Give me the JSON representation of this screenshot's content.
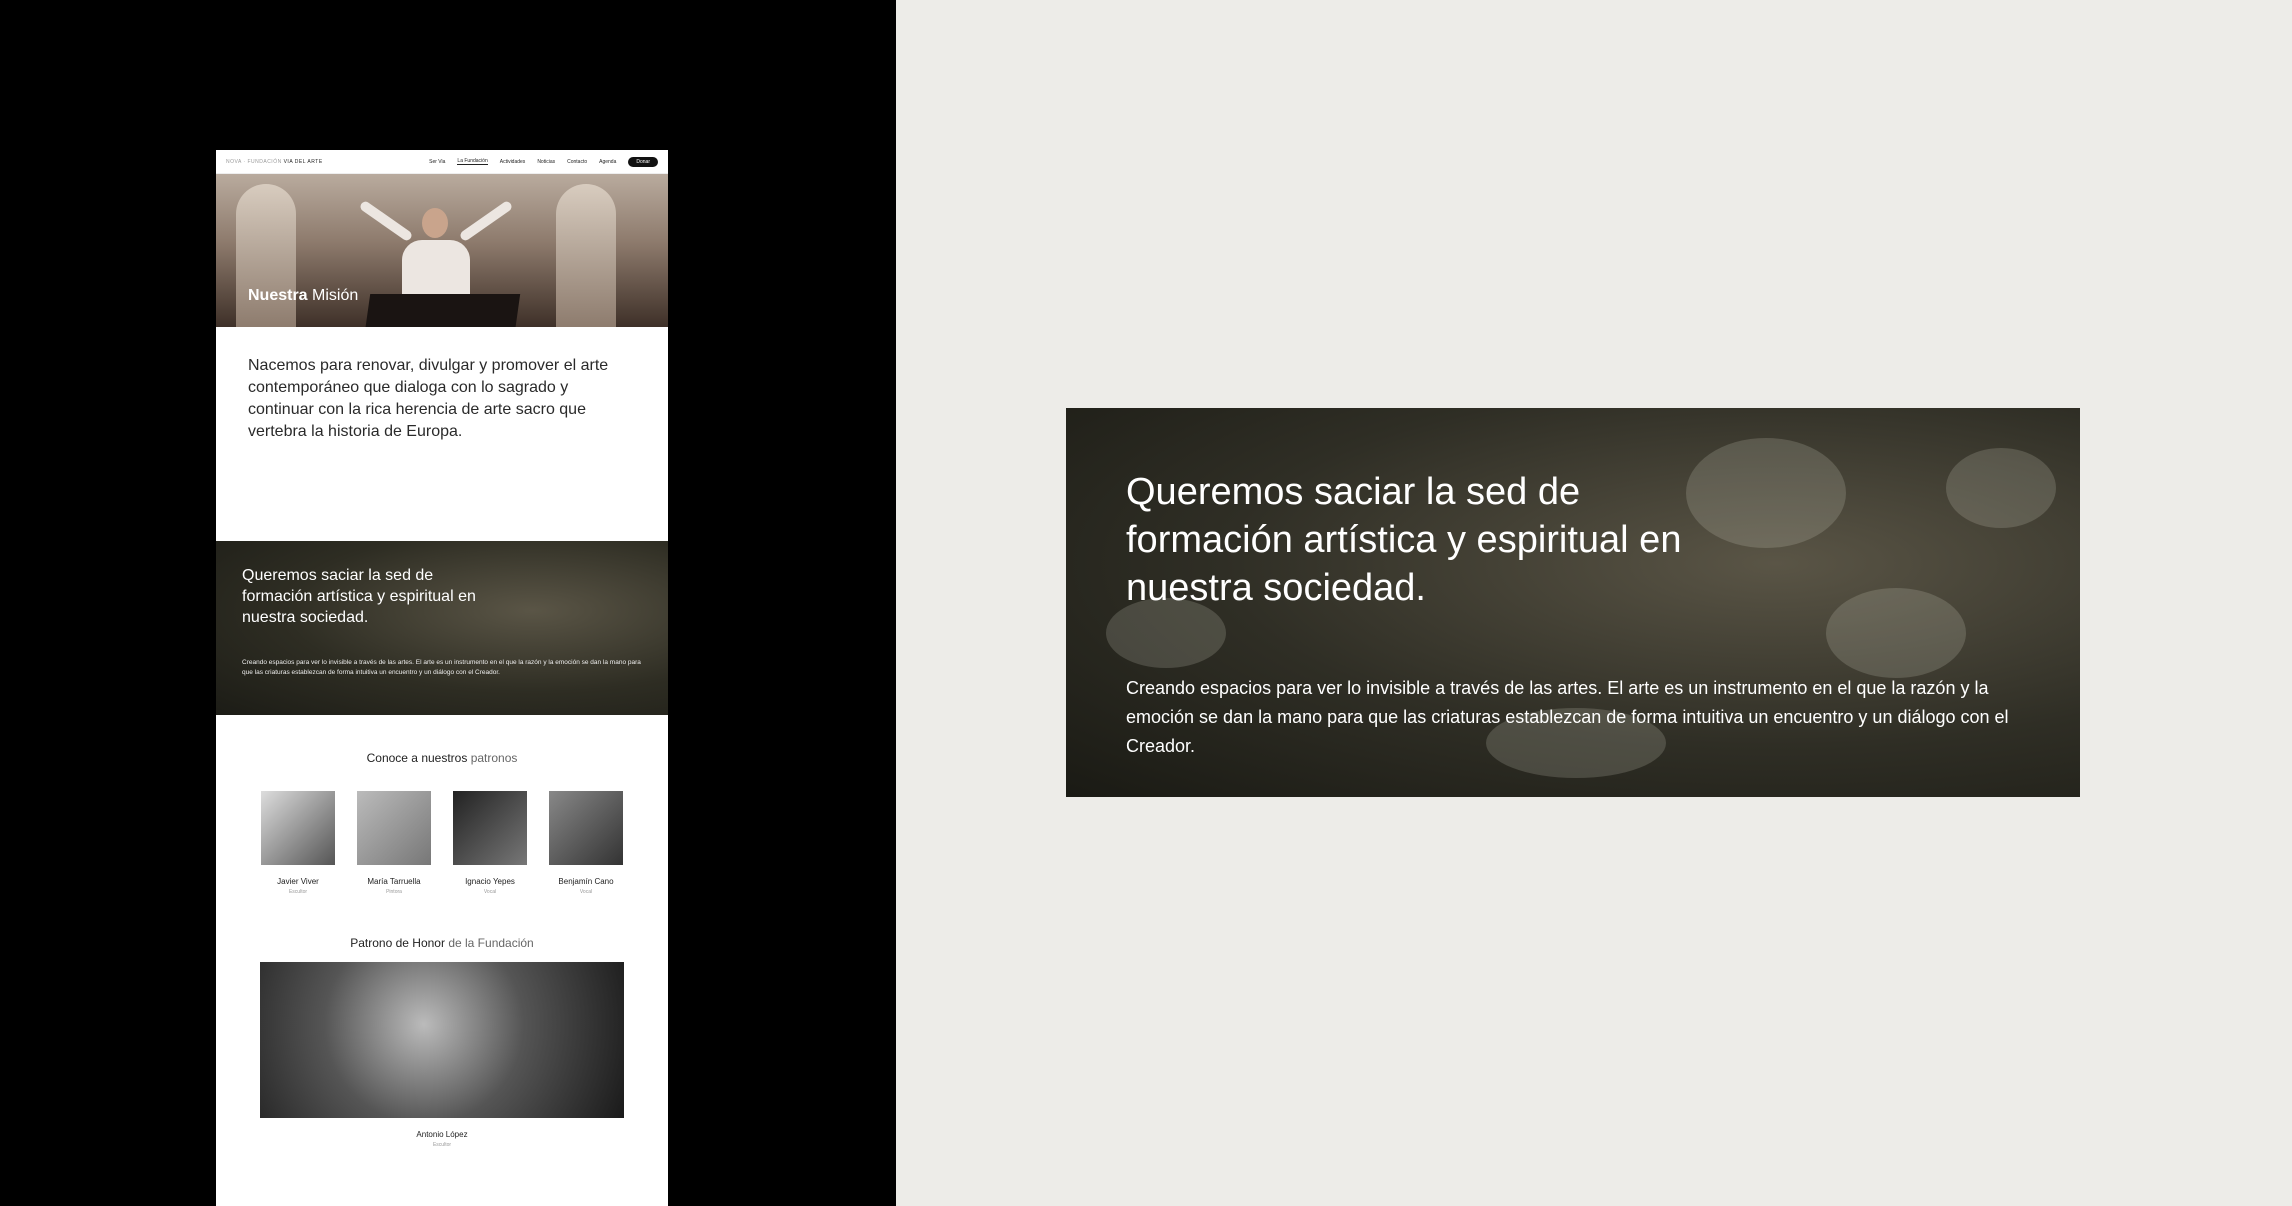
{
  "site": {
    "nav": {
      "logo_prefix": "NOVA · FUNDACIÓN",
      "logo_main": "VIA DEL ARTE",
      "links": [
        "Ser Via",
        "La Fundación",
        "Actividades",
        "Noticias",
        "Contacto",
        "Agenda"
      ],
      "donate": "Donar"
    },
    "hero": {
      "title_bold": "Nuestra",
      "title_light": "Misión"
    },
    "mission_text": "Nacemos para renovar, divulgar y promover el arte contemporáneo que dialoga con lo sagrado y continuar con la rica herencia de arte sacro que vertebra la historia de Europa.",
    "quote": {
      "heading": "Queremos saciar la sed de formación artística y espiritual en nuestra sociedad.",
      "body": "Creando espacios para ver lo invisible a través de las artes. El arte es un instrumento en el que la razón y la emoción se dan la mano para que las criaturas establezcan de forma intuitiva un encuentro y un diálogo con el Creador."
    },
    "patrons": {
      "heading_main": "Conoce a nuestros",
      "heading_light": "patronos",
      "items": [
        {
          "name": "Javier Viver",
          "role": "Escultor"
        },
        {
          "name": "María Tarruella",
          "role": "Pintora"
        },
        {
          "name": "Ignacio Yepes",
          "role": "Vocal"
        },
        {
          "name": "Benjamín Cano",
          "role": "Vocal"
        }
      ]
    },
    "honor": {
      "heading_main": "Patrono de Honor",
      "heading_light": "de la Fundación",
      "name": "Antonio López",
      "role": "Escultor"
    }
  },
  "card": {
    "heading": "Queremos saciar la sed de formación artística y espiritual en nuestra sociedad.",
    "body": "Creando espacios para ver lo invisible a través de las artes. El arte es un instrumento en el que la razón y la emoción se dan la mano para que las criaturas establezcan de forma intuitiva un encuentro y un diálogo con el Creador."
  }
}
